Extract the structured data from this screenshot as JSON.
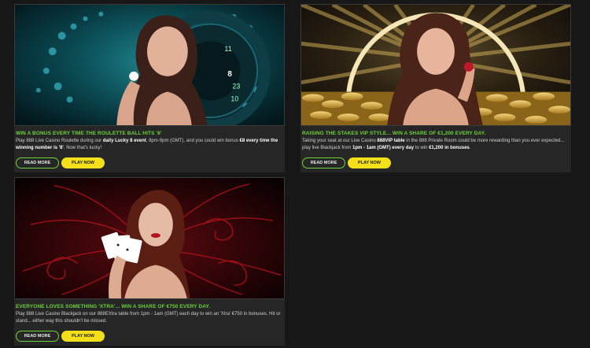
{
  "colors": {
    "accent_green": "#6dd23a",
    "play_yellow": "#f3e01a",
    "background": "#171717",
    "card": "#262626"
  },
  "cards": [
    {
      "image_subject": "roulette wheel promotion with woman holding a chip",
      "wheel_numbers": [
        "11",
        "8",
        "23",
        "10"
      ],
      "headline": "WIN A BONUS EVERY TIME THE ROULETTE BALL HITS '8'",
      "desc_parts": [
        {
          "t": "Play 888 Live Casino Roulette during our ",
          "b": false
        },
        {
          "t": "daily Lucky 8 event",
          "b": true
        },
        {
          "t": ", 8pm-9pm (GMT), and you could win bonus ",
          "b": false
        },
        {
          "t": "€8 every time the winning number is '8'",
          "b": true
        },
        {
          "t": ". Now that's lucky!",
          "b": false
        }
      ],
      "read_more": "READ MORE",
      "play_now": "PLAY NOW"
    },
    {
      "image_subject": "gold coins and sunburst with woman holding a chip",
      "headline": "RAISING THE STAKES VIP STYLE... WIN A SHARE OF €1,200 EVERY DAY.",
      "desc_parts": [
        {
          "t": "Taking your seat at our Live Casino ",
          "b": false
        },
        {
          "t": "888VIP table",
          "b": true
        },
        {
          "t": " in the 888 Private Room could be more rewarding than you ever expected... play live Blackjack from ",
          "b": false
        },
        {
          "t": "1pm - 1am (GMT) every day",
          "b": true
        },
        {
          "t": " to win ",
          "b": false
        },
        {
          "t": "€1,200 in bonuses",
          "b": true
        },
        {
          "t": ".",
          "b": false
        }
      ],
      "read_more": "READ MORE",
      "play_now": "PLAY NOW"
    },
    {
      "image_subject": "red swirl background with woman holding playing cards",
      "headline": "EVERYONE LOVES SOMETHING 'XTRA'... WIN A SHARE OF €750 EVERY DAY.",
      "desc_parts": [
        {
          "t": "Play 888 Live Casino Blackjack on our 888EXtra table from 1pm - 1am (GMT) each day to win an 'Xtra' €750 in bonuses. Hit or stand... either way this shouldn't be missed.",
          "b": false
        }
      ],
      "read_more": "READ MORE",
      "play_now": "PLAY NOW"
    }
  ]
}
